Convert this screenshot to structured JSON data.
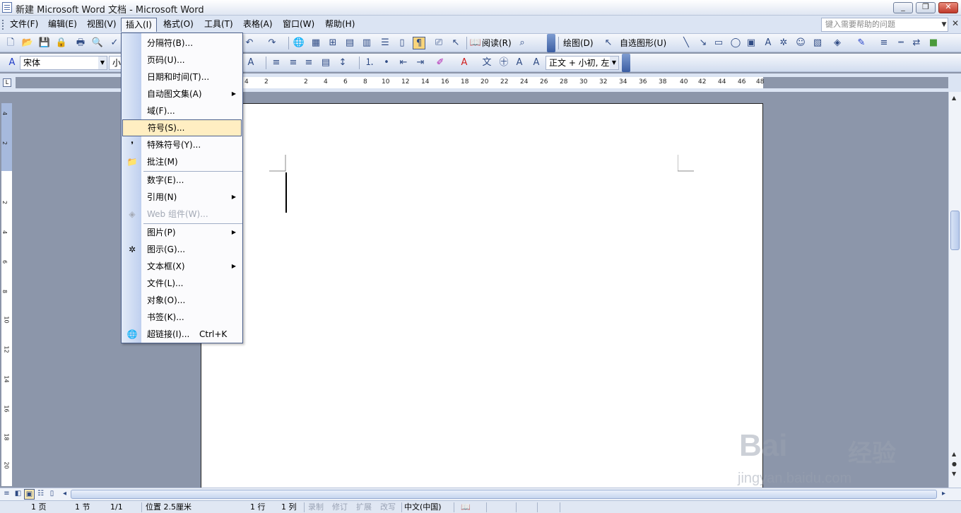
{
  "window": {
    "title": "新建 Microsoft Word 文档 - Microsoft Word"
  },
  "menubar": {
    "items": [
      "文件(F)",
      "编辑(E)",
      "视图(V)",
      "插入(I)",
      "格式(O)",
      "工具(T)",
      "表格(A)",
      "窗口(W)",
      "帮助(H)"
    ],
    "help_placeholder": "键入需要帮助的问题"
  },
  "toolbar1": {
    "read_label": "阅读(R)",
    "draw_label": "绘图(D)",
    "autoshape_label": "自选图形(U)"
  },
  "toolbar2": {
    "font_name": "宋体",
    "font_size": "小",
    "style_value": "正文 + 小初, 左,"
  },
  "ruler": {
    "h_numbers": [
      "4",
      "2",
      "2",
      "2",
      "4",
      "6",
      "8",
      "10",
      "12",
      "14",
      "16",
      "18",
      "20",
      "22",
      "24",
      "26",
      "28",
      "30",
      "32",
      "34",
      "36",
      "38",
      "40",
      "42",
      "44",
      "46",
      "48"
    ],
    "v_numbers": [
      "4",
      "2",
      "2",
      "4",
      "6",
      "8",
      "10",
      "12",
      "14",
      "16",
      "18",
      "20"
    ]
  },
  "insert_menu": {
    "items": [
      {
        "label": "分隔符(B)...",
        "icon": "",
        "submenu": false,
        "disabled": false,
        "highlight": false
      },
      {
        "label": "页码(U)...",
        "icon": "",
        "submenu": false,
        "disabled": false,
        "highlight": false
      },
      {
        "label": "日期和时间(T)...",
        "icon": "",
        "submenu": false,
        "disabled": false,
        "highlight": false
      },
      {
        "label": "自动图文集(A)",
        "icon": "",
        "submenu": true,
        "disabled": false,
        "highlight": false
      },
      {
        "label": "域(F)...",
        "icon": "",
        "submenu": false,
        "disabled": false,
        "highlight": false
      },
      {
        "label": "符号(S)...",
        "icon": "",
        "submenu": false,
        "disabled": false,
        "highlight": true
      },
      {
        "label": "特殊符号(Y)...",
        "icon": "comma-icon",
        "submenu": false,
        "disabled": false,
        "highlight": false
      },
      {
        "label": "批注(M)",
        "icon": "comment-icon",
        "submenu": false,
        "disabled": false,
        "highlight": false
      },
      {
        "label": "数字(E)...",
        "icon": "",
        "submenu": false,
        "disabled": false,
        "highlight": false
      },
      {
        "label": "引用(N)",
        "icon": "",
        "submenu": true,
        "disabled": false,
        "highlight": false
      },
      {
        "label": "Web 组件(W)...",
        "icon": "web-component-icon",
        "submenu": false,
        "disabled": true,
        "highlight": false
      },
      {
        "label": "图片(P)",
        "icon": "",
        "submenu": true,
        "disabled": false,
        "highlight": false
      },
      {
        "label": "图示(G)...",
        "icon": "diagram-icon",
        "submenu": false,
        "disabled": false,
        "highlight": false
      },
      {
        "label": "文本框(X)",
        "icon": "",
        "submenu": true,
        "disabled": false,
        "highlight": false
      },
      {
        "label": "文件(L)...",
        "icon": "",
        "submenu": false,
        "disabled": false,
        "highlight": false
      },
      {
        "label": "对象(O)...",
        "icon": "",
        "submenu": false,
        "disabled": false,
        "highlight": false
      },
      {
        "label": "书签(K)...",
        "icon": "",
        "submenu": false,
        "disabled": false,
        "highlight": false
      },
      {
        "label": "超链接(I)...",
        "icon": "hyperlink-icon",
        "submenu": false,
        "disabled": false,
        "highlight": false,
        "shortcut": "Ctrl+K"
      }
    ]
  },
  "statusbar": {
    "page": "1 页",
    "section": "1 节",
    "page_of": "1/1",
    "position": "位置 2.5厘米",
    "line": "1 行",
    "column": "1 列",
    "rec": "录制",
    "trk": "修订",
    "ext": "扩展",
    "ovr": "改写",
    "language": "中文(中国)"
  },
  "watermark": {
    "brand": "Bai",
    "brand_cn": "经验",
    "url": "jingyan.baidu.com"
  },
  "colors": {
    "highlight": "#ffeec2",
    "menu_border": "#4b5f8a",
    "workspace": "#8c96aa"
  }
}
